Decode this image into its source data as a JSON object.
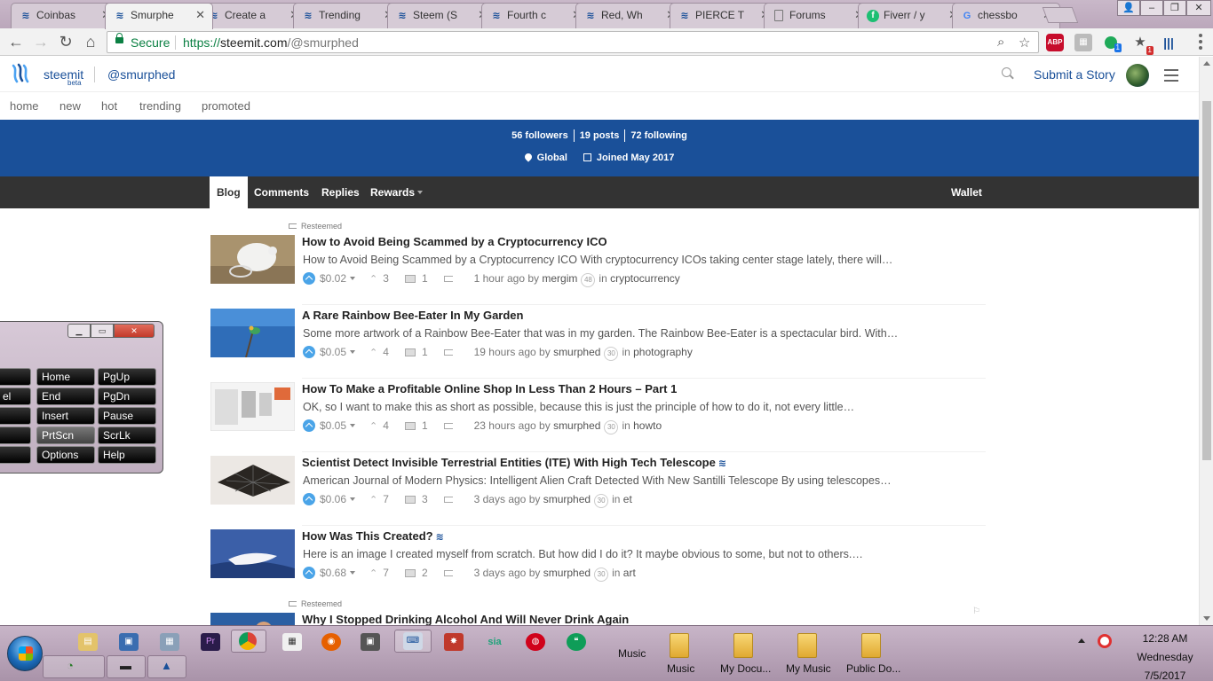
{
  "browser": {
    "tabs": [
      {
        "title": "Coinbas",
        "icon": "steemit-icon"
      },
      {
        "title": "Smurphe",
        "icon": "steemit-icon",
        "active": true
      },
      {
        "title": "Create a",
        "icon": "steemit-icon"
      },
      {
        "title": "Trending",
        "icon": "steemit-icon"
      },
      {
        "title": "Steem (S",
        "icon": "steemit-icon"
      },
      {
        "title": "Fourth c",
        "icon": "steemit-icon"
      },
      {
        "title": "Red, Wh",
        "icon": "steemit-icon"
      },
      {
        "title": "PIERCE T",
        "icon": "steemit-icon"
      },
      {
        "title": "Forums",
        "icon": "document-icon"
      },
      {
        "title": "Fiverr / y",
        "icon": "fiverr-icon"
      },
      {
        "title": "chessbo",
        "icon": "google-icon"
      }
    ],
    "security_label": "Secure",
    "url_scheme": "https://",
    "url_host": "steemit.com",
    "url_path": "/@smurphed",
    "ext_abp": "ABP",
    "ext_badge_1": "1",
    "ext_badge_2": "1"
  },
  "site": {
    "brand": "steemit",
    "beta": "beta",
    "profile_handle": "@smurphed",
    "submit": "Submit a Story",
    "subnav": [
      "home",
      "new",
      "hot",
      "trending",
      "promoted"
    ]
  },
  "profile": {
    "followers": "56 followers",
    "posts": "19 posts",
    "following": "72 following",
    "location": "Global",
    "joined": "Joined May 2017",
    "tabs": [
      "Blog",
      "Comments",
      "Replies",
      "Rewards"
    ],
    "wallet": "Wallet"
  },
  "posts": [
    {
      "resteemed": "Resteemed",
      "title": "How to Avoid Being Scammed by a Cryptocurrency ICO",
      "body": "How to Avoid Being Scammed by a Cryptocurrency ICO With cryptocurrency ICOs taking center stage lately, there will…",
      "payout": "$0.02",
      "votes": "3",
      "comments": "1",
      "time": "1 hour ago",
      "by": "by",
      "author": "mergim",
      "rep": "48",
      "in": "in",
      "category": "cryptocurrency"
    },
    {
      "title": "A Rare Rainbow Bee-Eater In My Garden",
      "body": "Some more artwork of a Rainbow Bee-Eater that was in my garden. The Rainbow Bee-Eater is a spectacular bird. With…",
      "payout": "$0.05",
      "votes": "4",
      "comments": "1",
      "time": "19 hours ago",
      "by": "by",
      "author": "smurphed",
      "rep": "30",
      "in": "in",
      "category": "photography"
    },
    {
      "title": "How To Make a Profitable Online Shop In Less Than 2 Hours – Part 1",
      "body": "OK, so I want to make this as short as possible, because this is just the principle of how to do it, not every little…",
      "payout": "$0.05",
      "votes": "4",
      "comments": "1",
      "time": "23 hours ago",
      "by": "by",
      "author": "smurphed",
      "rep": "30",
      "in": "in",
      "category": "howto"
    },
    {
      "title": "Scientist Detect Invisible Terrestrial Entities (ITE) With High Tech Telescope",
      "body": "American Journal of Modern Physics: Intelligent Alien Craft Detected With New Santilli Telescope By using telescopes…",
      "payout": "$0.06",
      "votes": "7",
      "comments": "3",
      "time": "3 days ago",
      "by": "by",
      "author": "smurphed",
      "rep": "30",
      "in": "in",
      "category": "et"
    },
    {
      "title": "How Was This Created?",
      "body": "Here is an image I created myself from scratch. But how did I do it? It maybe obvious to some, but not to others.…",
      "payout": "$0.68",
      "votes": "7",
      "comments": "2",
      "time": "3 days ago",
      "by": "by",
      "author": "smurphed",
      "rep": "30",
      "in": "in",
      "category": "art"
    },
    {
      "resteemed": "Resteemed",
      "title": "Why I Stopped Drinking Alcohol And Will Never Drink Again"
    }
  ],
  "keyboard": {
    "rows": [
      [
        "Home",
        "PgUp"
      ],
      [
        "End",
        "PgDn"
      ],
      [
        "Insert",
        "Pause"
      ],
      [
        "PrtScn",
        "ScrLk"
      ],
      [
        "Options",
        "Help"
      ]
    ],
    "left_fragment": "el"
  },
  "taskbar": {
    "music_toolbar": "Music",
    "folders": [
      "Music",
      "My Docu...",
      "My Music",
      "Public Do..."
    ],
    "time": "12:28 AM",
    "day": "Wednesday",
    "date": "7/5/2017",
    "sia_label": "sia"
  }
}
